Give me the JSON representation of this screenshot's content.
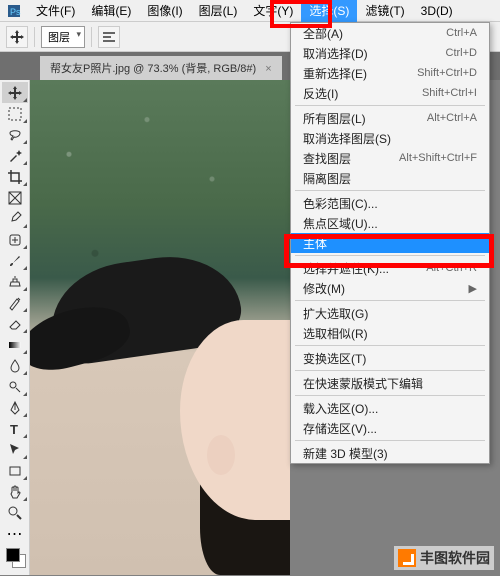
{
  "menubar": {
    "items": [
      "文件(F)",
      "编辑(E)",
      "图像(I)",
      "图层(L)",
      "文字(Y)",
      "选择(S)",
      "滤镜(T)",
      "3D(D)"
    ],
    "active_index": 5
  },
  "toolbar": {
    "layer_dropdown": "图层"
  },
  "tab": {
    "title": "帮女友P照片.jpg @ 73.3% (背景, RGB/8#)",
    "close": "×"
  },
  "dropdown": {
    "sections": [
      [
        {
          "label": "全部(A)",
          "shortcut": "Ctrl+A"
        },
        {
          "label": "取消选择(D)",
          "shortcut": "Ctrl+D"
        },
        {
          "label": "重新选择(E)",
          "shortcut": "Shift+Ctrl+D"
        },
        {
          "label": "反选(I)",
          "shortcut": "Shift+Ctrl+I"
        }
      ],
      [
        {
          "label": "所有图层(L)",
          "shortcut": "Alt+Ctrl+A"
        },
        {
          "label": "取消选择图层(S)",
          "shortcut": ""
        },
        {
          "label": "查找图层",
          "shortcut": "Alt+Shift+Ctrl+F"
        },
        {
          "label": "隔离图层",
          "shortcut": ""
        }
      ],
      [
        {
          "label": "色彩范围(C)...",
          "shortcut": ""
        },
        {
          "label": "焦点区域(U)...",
          "shortcut": ""
        },
        {
          "label": "主体",
          "shortcut": "",
          "highlight": true
        }
      ],
      [
        {
          "label": "选择并遮住(K)...",
          "shortcut": "Alt+Ctrl+R"
        },
        {
          "label": "修改(M)",
          "shortcut": "▶"
        }
      ],
      [
        {
          "label": "扩大选取(G)",
          "shortcut": ""
        },
        {
          "label": "选取相似(R)",
          "shortcut": ""
        }
      ],
      [
        {
          "label": "变换选区(T)",
          "shortcut": ""
        }
      ],
      [
        {
          "label": "在快速蒙版模式下编辑",
          "shortcut": ""
        }
      ],
      [
        {
          "label": "载入选区(O)...",
          "shortcut": ""
        },
        {
          "label": "存储选区(V)...",
          "shortcut": ""
        }
      ],
      [
        {
          "label": "新建 3D 模型(3)",
          "shortcut": ""
        }
      ]
    ]
  },
  "watermark": {
    "text": "丰图软件园"
  }
}
